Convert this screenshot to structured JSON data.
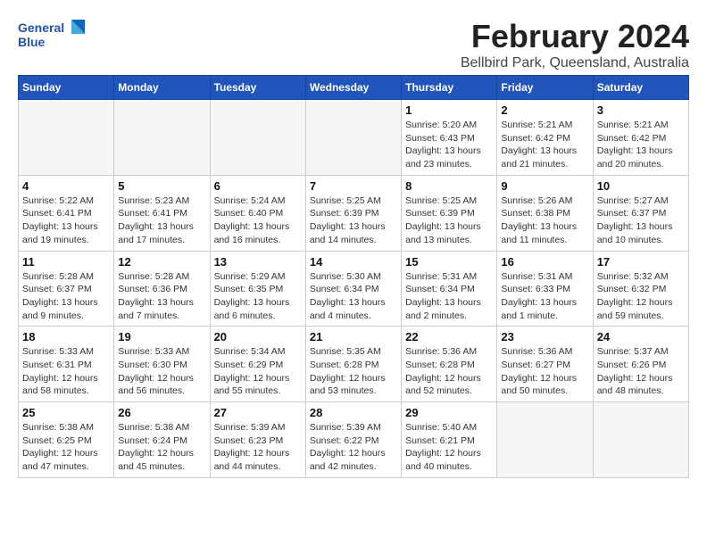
{
  "logo": {
    "line1": "General",
    "line2": "Blue"
  },
  "header": {
    "month_year": "February 2024",
    "location": "Bellbird Park, Queensland, Australia"
  },
  "weekdays": [
    "Sunday",
    "Monday",
    "Tuesday",
    "Wednesday",
    "Thursday",
    "Friday",
    "Saturday"
  ],
  "weeks": [
    [
      {
        "day": "",
        "info": ""
      },
      {
        "day": "",
        "info": ""
      },
      {
        "day": "",
        "info": ""
      },
      {
        "day": "",
        "info": ""
      },
      {
        "day": "1",
        "info": "Sunrise: 5:20 AM\nSunset: 6:43 PM\nDaylight: 13 hours\nand 23 minutes."
      },
      {
        "day": "2",
        "info": "Sunrise: 5:21 AM\nSunset: 6:42 PM\nDaylight: 13 hours\nand 21 minutes."
      },
      {
        "day": "3",
        "info": "Sunrise: 5:21 AM\nSunset: 6:42 PM\nDaylight: 13 hours\nand 20 minutes."
      }
    ],
    [
      {
        "day": "4",
        "info": "Sunrise: 5:22 AM\nSunset: 6:41 PM\nDaylight: 13 hours\nand 19 minutes."
      },
      {
        "day": "5",
        "info": "Sunrise: 5:23 AM\nSunset: 6:41 PM\nDaylight: 13 hours\nand 17 minutes."
      },
      {
        "day": "6",
        "info": "Sunrise: 5:24 AM\nSunset: 6:40 PM\nDaylight: 13 hours\nand 16 minutes."
      },
      {
        "day": "7",
        "info": "Sunrise: 5:25 AM\nSunset: 6:39 PM\nDaylight: 13 hours\nand 14 minutes."
      },
      {
        "day": "8",
        "info": "Sunrise: 5:25 AM\nSunset: 6:39 PM\nDaylight: 13 hours\nand 13 minutes."
      },
      {
        "day": "9",
        "info": "Sunrise: 5:26 AM\nSunset: 6:38 PM\nDaylight: 13 hours\nand 11 minutes."
      },
      {
        "day": "10",
        "info": "Sunrise: 5:27 AM\nSunset: 6:37 PM\nDaylight: 13 hours\nand 10 minutes."
      }
    ],
    [
      {
        "day": "11",
        "info": "Sunrise: 5:28 AM\nSunset: 6:37 PM\nDaylight: 13 hours\nand 9 minutes."
      },
      {
        "day": "12",
        "info": "Sunrise: 5:28 AM\nSunset: 6:36 PM\nDaylight: 13 hours\nand 7 minutes."
      },
      {
        "day": "13",
        "info": "Sunrise: 5:29 AM\nSunset: 6:35 PM\nDaylight: 13 hours\nand 6 minutes."
      },
      {
        "day": "14",
        "info": "Sunrise: 5:30 AM\nSunset: 6:34 PM\nDaylight: 13 hours\nand 4 minutes."
      },
      {
        "day": "15",
        "info": "Sunrise: 5:31 AM\nSunset: 6:34 PM\nDaylight: 13 hours\nand 2 minutes."
      },
      {
        "day": "16",
        "info": "Sunrise: 5:31 AM\nSunset: 6:33 PM\nDaylight: 13 hours\nand 1 minute."
      },
      {
        "day": "17",
        "info": "Sunrise: 5:32 AM\nSunset: 6:32 PM\nDaylight: 12 hours\nand 59 minutes."
      }
    ],
    [
      {
        "day": "18",
        "info": "Sunrise: 5:33 AM\nSunset: 6:31 PM\nDaylight: 12 hours\nand 58 minutes."
      },
      {
        "day": "19",
        "info": "Sunrise: 5:33 AM\nSunset: 6:30 PM\nDaylight: 12 hours\nand 56 minutes."
      },
      {
        "day": "20",
        "info": "Sunrise: 5:34 AM\nSunset: 6:29 PM\nDaylight: 12 hours\nand 55 minutes."
      },
      {
        "day": "21",
        "info": "Sunrise: 5:35 AM\nSunset: 6:28 PM\nDaylight: 12 hours\nand 53 minutes."
      },
      {
        "day": "22",
        "info": "Sunrise: 5:36 AM\nSunset: 6:28 PM\nDaylight: 12 hours\nand 52 minutes."
      },
      {
        "day": "23",
        "info": "Sunrise: 5:36 AM\nSunset: 6:27 PM\nDaylight: 12 hours\nand 50 minutes."
      },
      {
        "day": "24",
        "info": "Sunrise: 5:37 AM\nSunset: 6:26 PM\nDaylight: 12 hours\nand 48 minutes."
      }
    ],
    [
      {
        "day": "25",
        "info": "Sunrise: 5:38 AM\nSunset: 6:25 PM\nDaylight: 12 hours\nand 47 minutes."
      },
      {
        "day": "26",
        "info": "Sunrise: 5:38 AM\nSunset: 6:24 PM\nDaylight: 12 hours\nand 45 minutes."
      },
      {
        "day": "27",
        "info": "Sunrise: 5:39 AM\nSunset: 6:23 PM\nDaylight: 12 hours\nand 44 minutes."
      },
      {
        "day": "28",
        "info": "Sunrise: 5:39 AM\nSunset: 6:22 PM\nDaylight: 12 hours\nand 42 minutes."
      },
      {
        "day": "29",
        "info": "Sunrise: 5:40 AM\nSunset: 6:21 PM\nDaylight: 12 hours\nand 40 minutes."
      },
      {
        "day": "",
        "info": ""
      },
      {
        "day": "",
        "info": ""
      }
    ]
  ]
}
